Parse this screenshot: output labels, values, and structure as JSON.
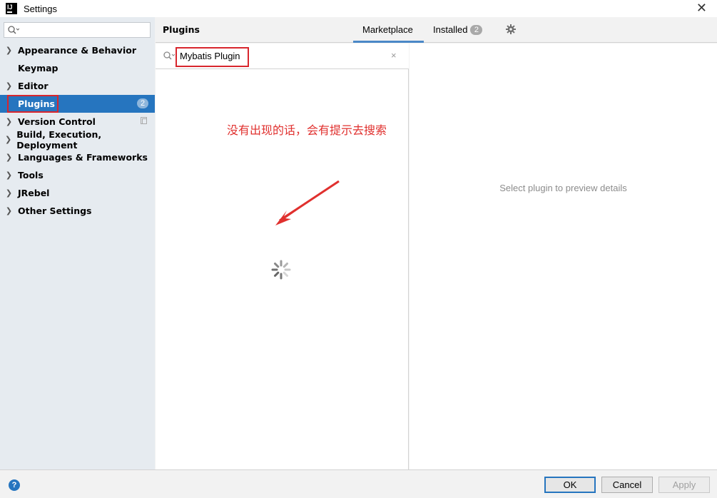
{
  "window": {
    "logo": "IJ",
    "title": "Settings",
    "close_glyph": "✕"
  },
  "sidebar": {
    "search_placeholder": "",
    "items": [
      {
        "label": "Appearance & Behavior",
        "expandable": true
      },
      {
        "label": "Keymap",
        "expandable": false
      },
      {
        "label": "Editor",
        "expandable": true
      },
      {
        "label": "Plugins",
        "expandable": false,
        "selected": true,
        "badge": "2"
      },
      {
        "label": "Version Control",
        "expandable": true
      },
      {
        "label": "Build, Execution, Deployment",
        "expandable": true
      },
      {
        "label": "Languages & Frameworks",
        "expandable": true
      },
      {
        "label": "Tools",
        "expandable": true
      },
      {
        "label": "JRebel",
        "expandable": true
      },
      {
        "label": "Other Settings",
        "expandable": true
      }
    ]
  },
  "header": {
    "title": "Plugins",
    "tabs": [
      {
        "label": "Marketplace",
        "active": true
      },
      {
        "label": "Installed",
        "badge": "2"
      }
    ],
    "settings_icon": "gear-icon"
  },
  "plugin_search": {
    "value": "Mybatis Plugin",
    "clear_glyph": "×"
  },
  "annotation": {
    "text": "没有出现的话，会有提示去搜索",
    "color": "#e0302e"
  },
  "detail": {
    "hint": "Select plugin to preview details"
  },
  "footer": {
    "help_glyph": "?",
    "ok_label": "OK",
    "cancel_label": "Cancel",
    "apply_label": "Apply"
  },
  "colors": {
    "accent": "#2675bf",
    "highlight": "#d8262d",
    "sidebar_bg": "#e6ebf0"
  }
}
